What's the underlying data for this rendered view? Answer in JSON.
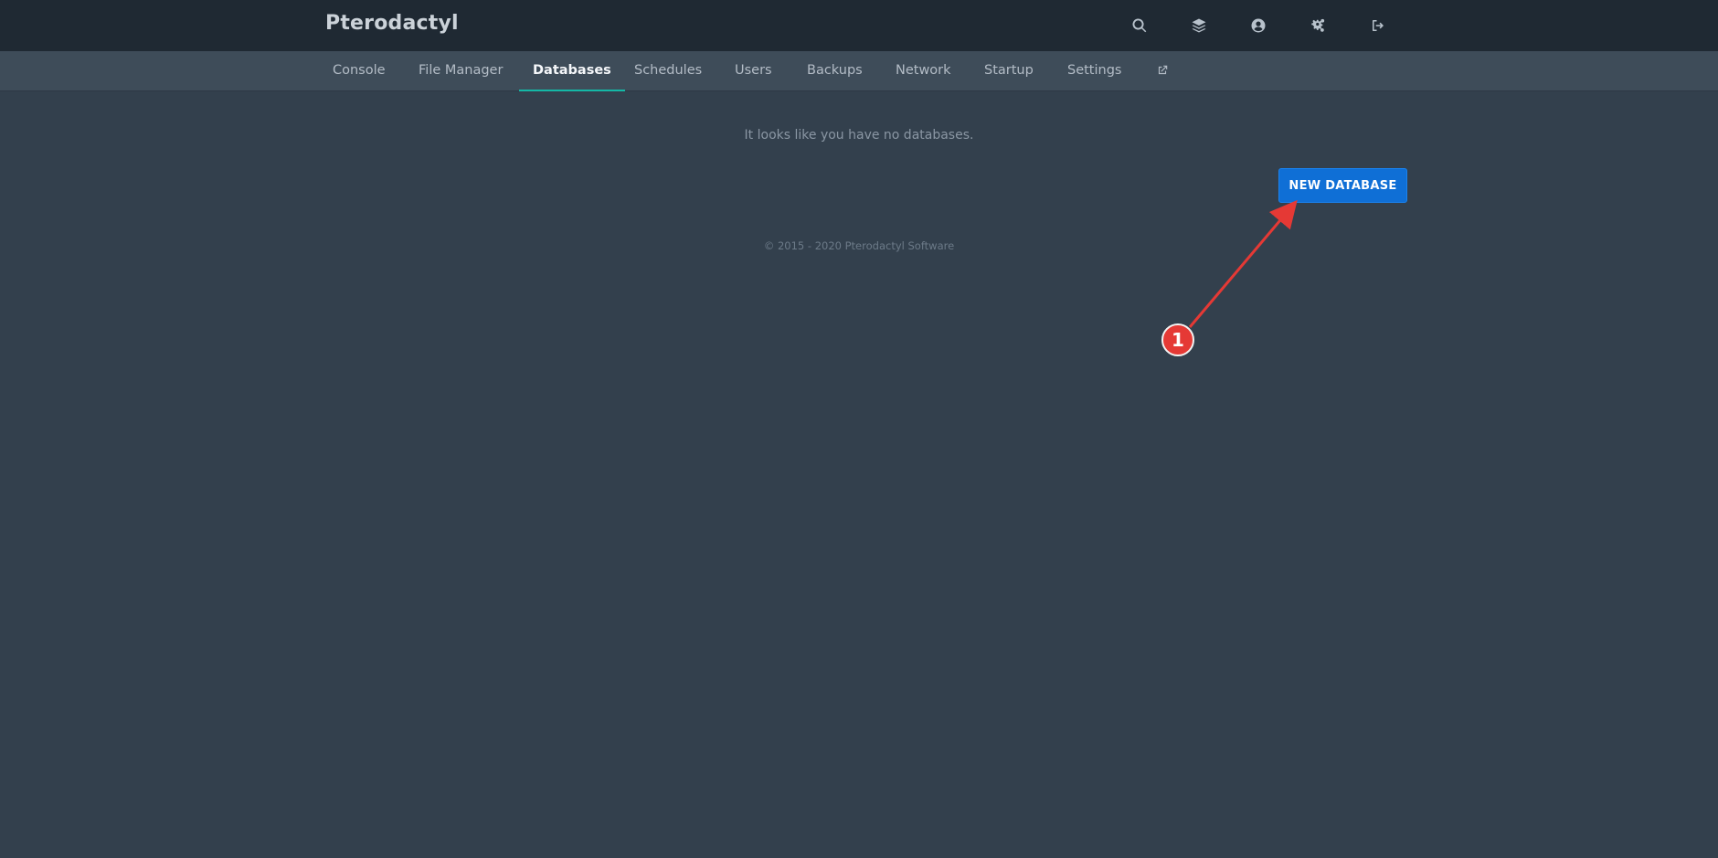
{
  "header": {
    "brand": "Pterodactyl",
    "icons": [
      {
        "name": "search-icon"
      },
      {
        "name": "layers-icon"
      },
      {
        "name": "user-circle-icon"
      },
      {
        "name": "cogs-icon"
      },
      {
        "name": "sign-out-icon"
      }
    ]
  },
  "subnav": {
    "tabs": [
      {
        "label": "Console"
      },
      {
        "label": "File Manager"
      },
      {
        "label": "Databases"
      },
      {
        "label": "Schedules"
      },
      {
        "label": "Users"
      },
      {
        "label": "Backups"
      },
      {
        "label": "Network"
      },
      {
        "label": "Startup"
      },
      {
        "label": "Settings"
      }
    ],
    "active_tab": "Databases",
    "external_link_icon": "external-link-icon"
  },
  "content": {
    "empty_message": "It looks like you have no databases.",
    "new_database_label": "NEW DATABASE"
  },
  "footer": {
    "copyright": "© 2015 - 2020 Pterodactyl Software"
  },
  "annotation": {
    "marker_label": "1"
  },
  "colors": {
    "header_bg": "#1f2933",
    "nav_bg": "#3e4c59",
    "page_bg": "#33404d",
    "active_tab_underline": "#14b8a6",
    "primary_button": "#0f6fd6",
    "annotation_red": "#e53935"
  }
}
